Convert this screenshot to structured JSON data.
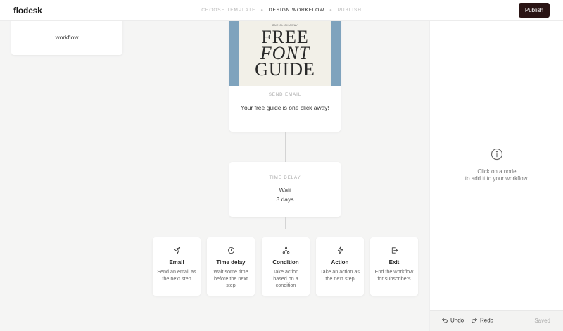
{
  "app": {
    "logo": "flodesk"
  },
  "steps": [
    {
      "label": "CHOOSE TEMPLATE",
      "active": false
    },
    {
      "label": "DESIGN WORKFLOW",
      "active": true
    },
    {
      "label": "PUBLISH",
      "active": false
    }
  ],
  "header": {
    "publish_label": "Publish"
  },
  "canvas": {
    "prev_node_text": "workflow",
    "email_node": {
      "image_kicker": "ONE CLICK AWAY",
      "image_line1": "FREE",
      "image_line2": "FONT",
      "image_line3": "GUIDE",
      "label": "SEND EMAIL",
      "subject": "Your free guide is one click away!"
    },
    "delay_node": {
      "label": "TIME DELAY",
      "line1": "Wait",
      "line2": "3 days"
    },
    "options": [
      {
        "icon": "send-icon",
        "title": "Email",
        "desc": "Send an email as the next step"
      },
      {
        "icon": "clock-icon",
        "title": "Time delay",
        "desc": "Wait some time before the next step"
      },
      {
        "icon": "branch-icon",
        "title": "Condition",
        "desc": "Take action based on a condition"
      },
      {
        "icon": "lightning-icon",
        "title": "Action",
        "desc": "Take an action as the next step"
      },
      {
        "icon": "exit-icon",
        "title": "Exit",
        "desc": "End the workflow for subscribers"
      }
    ]
  },
  "panel": {
    "hint_line1": "Click on a node",
    "hint_line2": "to add it to your workflow.",
    "undo_label": "Undo",
    "redo_label": "Redo",
    "saved_label": "Saved"
  },
  "colors": {
    "publish_bg": "#2a1414",
    "image_frame": "#7fa3bd",
    "image_bg": "#f2f0e8"
  }
}
